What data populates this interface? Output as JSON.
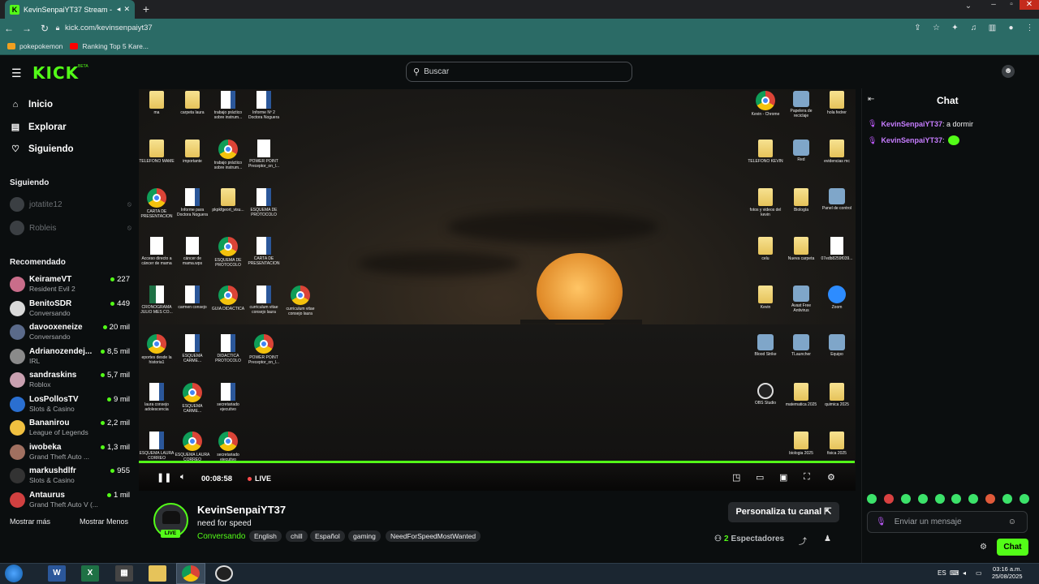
{
  "browser": {
    "tab_title": "KevinSenpaiYT37 Stream - W",
    "url": "kick.com/kevinsenpaiyt37",
    "bookmarks": [
      "pokepokemon",
      "Ranking Top 5 Kare..."
    ]
  },
  "header": {
    "logo": "KICK",
    "beta": "BETA",
    "search_placeholder": "Buscar"
  },
  "sidebar": {
    "nav": [
      "Inicio",
      "Explorar",
      "Siguiendo"
    ],
    "following_title": "Siguiendo",
    "following": [
      "jotatite12",
      "Robleis"
    ],
    "recommended_title": "Recomendado",
    "recommended": [
      {
        "name": "KeirameVT",
        "game": "Resident Evil 2",
        "viewers": "227",
        "color": "#c96d8a"
      },
      {
        "name": "BenitoSDR",
        "game": "Conversando",
        "viewers": "449",
        "color": "#d9d9d9"
      },
      {
        "name": "davooxeneize",
        "game": "Conversando",
        "viewers": "20 mil",
        "color": "#5a6a8a"
      },
      {
        "name": "Adrianozendej...",
        "game": "IRL",
        "viewers": "8,5 mil",
        "color": "#8a8a8a"
      },
      {
        "name": "sandraskins",
        "game": "Roblox",
        "viewers": "5,7 mil",
        "color": "#c9a0b0"
      },
      {
        "name": "LosPollosTV",
        "game": "Slots & Casino",
        "viewers": "9 mil",
        "color": "#2a6fd1"
      },
      {
        "name": "Bananirou",
        "game": "League of Legends",
        "viewers": "2,2 mil",
        "color": "#f0c040"
      },
      {
        "name": "iwobeka",
        "game": "Grand Theft Auto ...",
        "viewers": "1,3 mil",
        "color": "#a07060"
      },
      {
        "name": "markushdlfr",
        "game": "Slots & Casino",
        "viewers": "955",
        "color": "#333333"
      },
      {
        "name": "Antaurus",
        "game": "Grand Theft Auto V (...",
        "viewers": "1 mil",
        "color": "#d04040"
      }
    ],
    "show_more": "Mostrar más",
    "show_less": "Mostrar Menos"
  },
  "desktop_left": [
    [
      "ma",
      "carpeta laura",
      "trabajo práctico sobre instrum...",
      "Informe Nº 2 Doctora Noguera"
    ],
    [
      "TELEFONO MAME",
      "importante",
      "trabajo práctico sobre instrum...",
      "POWER POINT Preceptor_on_l..."
    ],
    [
      "CARTA DE PRESENTACION",
      "Informe para Doctora Noguera",
      "pkpkfgeort_visu...",
      "ESQUEMA DE PROTOCOLO"
    ],
    [
      "Acceso directo a cáncer de mama",
      "cáncer de mama.wps",
      "ESQUEMA DE PROTOCOLO",
      "CARTA DE PRESENTACION"
    ],
    [
      "CRONOGRAMA JULIO MES CO...",
      "carmen consejo",
      "GUIA DIDACTICA",
      "curriculum vitae consejo laura",
      "curriculum vitae consejo laura"
    ],
    [
      "eportes desde la historia1",
      "ESQUEMA CARME...",
      "DIDACTICA PROTOCOLO",
      "POWER POINT Preceptor_on_l..."
    ],
    [
      "laura consejo adolescencia",
      "ESQUEMA CARME...",
      "secretariado ejecutivo"
    ],
    [
      "ESQUEMA LAURA CORREO",
      "ESQUEMA LAURA CORREO",
      "secretariado ejecutivo"
    ]
  ],
  "desktop_right": [
    [
      "Kevin - Chrome",
      "Papelera de reciclaje",
      "hola fedrer"
    ],
    [
      "TELEFONO KEVIN",
      "Red",
      "evidencias mc"
    ],
    [
      "fotos y videos del kevin",
      "Biología",
      "Panel de control"
    ],
    [
      "celu",
      "Nueva carpeta",
      "07edb8259f039..."
    ],
    [
      "Kevin",
      "Avast Free Antivirus",
      "Zoom"
    ],
    [
      "Blood Strike",
      "TLauncher",
      "Equipo"
    ],
    [
      "OBS Studio",
      "matematica 2025",
      "quimica 2025"
    ],
    [
      "",
      "biologia 2025",
      "fisica 2025"
    ]
  ],
  "player": {
    "time": "00:08:58",
    "live": "LIVE",
    "progress": 1.0
  },
  "stream": {
    "channel": "KevinSenpaiYT37",
    "live_badge": "LIVE",
    "title": "need for speed",
    "category": "Conversando",
    "tags": [
      "English",
      "chill",
      "Español",
      "gaming",
      "NeedForSpeedMostWanted"
    ],
    "personalize": "Personaliza tu canal",
    "viewers_count": "2",
    "viewers_label": "Espectadores"
  },
  "chat": {
    "title": "Chat",
    "messages": [
      {
        "user": "KevinSenpaiYT37",
        "text": ": a dormir",
        "emote": false
      },
      {
        "user": "KevinSenpaiYT37",
        "text": ":",
        "emote": true
      }
    ],
    "input_placeholder": "Enviar un mensaje",
    "send_button": "Chat"
  },
  "taskbar": {
    "apps": [
      "W",
      "X",
      "",
      "",
      "",
      ""
    ],
    "lang": "ES",
    "time": "03:16 a.m.",
    "date": "25/08/2025"
  },
  "colors": {
    "accent": "#53fc18",
    "chat_user": "#c77dff"
  }
}
